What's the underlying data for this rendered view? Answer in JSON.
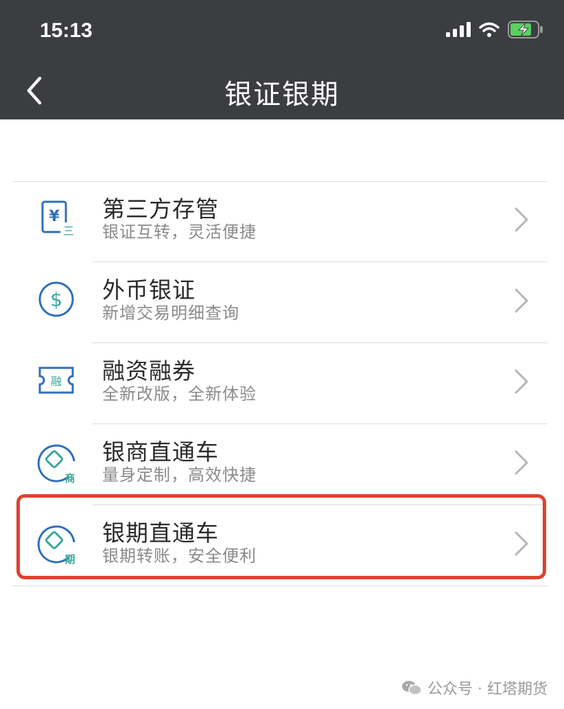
{
  "status_bar": {
    "time": "15:13"
  },
  "header": {
    "title": "银证银期"
  },
  "menu": [
    {
      "title": "第三方存管",
      "subtitle": "银证互转，灵活便捷",
      "icon": "yen-card-icon",
      "icon_label": "三"
    },
    {
      "title": "外币银证",
      "subtitle": "新增交易明细查询",
      "icon": "dollar-circle-icon",
      "icon_label": "$"
    },
    {
      "title": "融资融券",
      "subtitle": "全新改版，全新体验",
      "icon": "ticket-icon",
      "icon_label": "融"
    },
    {
      "title": "银商直通车",
      "subtitle": "量身定制，高效快捷",
      "icon": "diamond-circle-icon",
      "icon_label": "商"
    },
    {
      "title": "银期直通车",
      "subtitle": "银期转账，安全便利",
      "icon": "diamond-circle-icon",
      "icon_label": "期"
    }
  ],
  "watermark": {
    "text": "公众号 · 红塔期货"
  },
  "colors": {
    "header_bg": "#3c3d41",
    "icon_blue": "#2f6fb8",
    "icon_teal": "#3aa79a",
    "highlight": "#e0402f"
  }
}
